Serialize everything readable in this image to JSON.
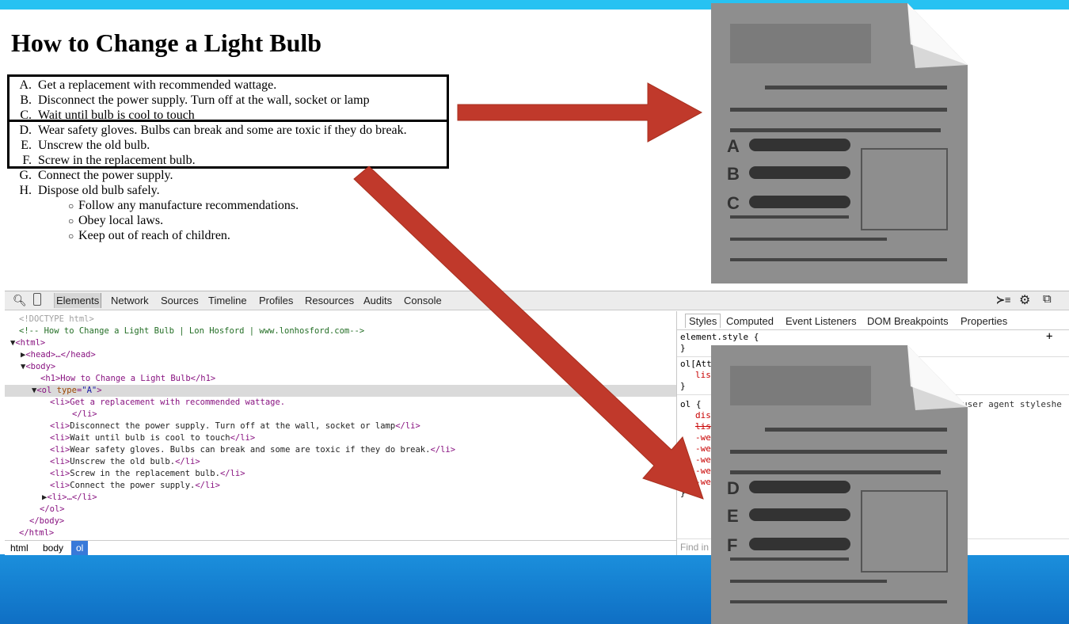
{
  "page": {
    "heading": "How to Change a Light Bulb",
    "ordered_items": [
      {
        "marker": "A.",
        "text": "Get a replacement with recommended wattage."
      },
      {
        "marker": "B.",
        "text": "Disconnect the power supply. Turn off at the wall, socket or lamp"
      },
      {
        "marker": "C.",
        "text": "Wait until bulb is cool to touch"
      },
      {
        "marker": "D.",
        "text": "Wear safety gloves. Bulbs can break and some are toxic if they do break."
      },
      {
        "marker": "E.",
        "text": "Unscrew the old bulb."
      },
      {
        "marker": "F.",
        "text": "Screw in the replacement bulb."
      },
      {
        "marker": "G.",
        "text": "Connect the power supply."
      },
      {
        "marker": "H.",
        "text": "Dispose old bulb safely."
      }
    ],
    "sub_items": [
      "Follow any manufacture recommendations.",
      "Obey local laws.",
      "Keep out of reach of children."
    ]
  },
  "devtools": {
    "tabs": [
      "Elements",
      "Network",
      "Sources",
      "Timeline",
      "Profiles",
      "Resources",
      "Audits",
      "Console"
    ],
    "dom": {
      "doctype": "<!DOCTYPE html>",
      "comment": "<!-- How to Change a Light Bulb | Lon Hosford | www.lonhosford.com-->",
      "html_open": "<html>",
      "head": "<head>…</head>",
      "body_open": "<body>",
      "h1_line": "<h1>How to Change a Light Bulb</h1>",
      "ol_tag": "ol",
      "ol_attr_name": "type",
      "ol_attr_value": "\"A\"",
      "li_first": "<li>Get a replacement with recommended wattage.",
      "li_first_close": "</li>",
      "li_lines": [
        "Disconnect the power supply. Turn off at the wall, socket or lamp",
        "Wait until bulb is cool to touch",
        "Wear safety gloves. Bulbs can break and some are toxic if they do break.",
        "Unscrew the old bulb.",
        "Screw in the replacement bulb.",
        "Connect the power supply."
      ],
      "li_collapsed": "<li>…</li>",
      "ol_close": "</ol>",
      "body_close": "</body>",
      "html_close": "</html>"
    },
    "breadcrumbs": [
      "html",
      "body",
      "ol"
    ],
    "styles_tabs": [
      "Styles",
      "Computed",
      "Event Listeners",
      "DOM Breakpoints",
      "Properties"
    ],
    "styles": {
      "element_style": "element.style {",
      "close_brace": "}",
      "rule2_selector": "ol[Att",
      "rule2_prop": "lis",
      "rule3_selector": "ol {",
      "rule3_source": "user agent styleshe",
      "rule3_props": [
        "dis",
        "lis",
        "-we",
        "-we",
        "-we",
        "-we",
        "-we"
      ],
      "find_placeholder": "Find in"
    }
  },
  "overlay": {
    "doc_top_letters": [
      "A",
      "B",
      "C"
    ],
    "doc_bottom_letters": [
      "D",
      "E",
      "F"
    ],
    "arrow_color": "#c0392b"
  }
}
